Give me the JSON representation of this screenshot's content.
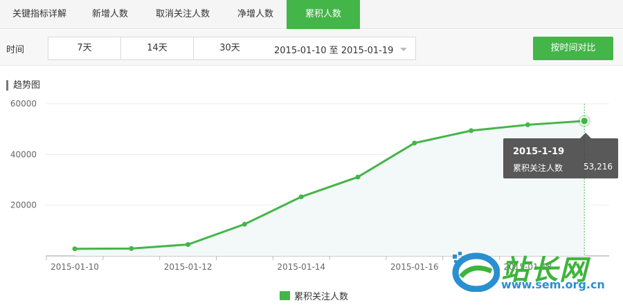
{
  "tabs": [
    {
      "label": "关键指标详解",
      "active": false
    },
    {
      "label": "新增人数",
      "active": false
    },
    {
      "label": "取消关注人数",
      "active": false
    },
    {
      "label": "净增人数",
      "active": false
    },
    {
      "label": "累积人数",
      "active": true
    }
  ],
  "filter": {
    "label": "时间",
    "periods": [
      "7天",
      "14天",
      "30天"
    ],
    "date_range": "2015-01-10 至 2015-01-19",
    "compare_button": "按时间对比"
  },
  "section_title": "趋势图",
  "tooltip": {
    "date": "2015-1-19",
    "series_name": "累积关注人数",
    "value": "53,216"
  },
  "legend": [
    "累积关注人数"
  ],
  "watermark": {
    "brand": "站长网",
    "url": "www.sem.org.cn"
  },
  "colors": {
    "accent": "#44b549",
    "tooltip_bg": "#3c3c3c",
    "watermark_url": "#2a8fd0"
  },
  "chart_data": {
    "type": "area",
    "x": [
      "2015-01-10",
      "2015-01-11",
      "2015-01-12",
      "2015-01-13",
      "2015-01-14",
      "2015-01-15",
      "2015-01-16",
      "2015-01-17",
      "2015-01-18",
      "2015-01-19"
    ],
    "xticks": [
      "2015-01-10",
      "2015-01-12",
      "2015-01-14",
      "2015-01-16",
      "2015-01-18"
    ],
    "series": [
      {
        "name": "累积关注人数",
        "values": [
          2800,
          2900,
          4500,
          12500,
          23300,
          31100,
          44500,
          49400,
          51700,
          53216
        ]
      }
    ],
    "yticks": [
      20000,
      40000,
      60000
    ],
    "ylim": [
      0,
      60000
    ],
    "grid": true,
    "highlight_index": 9,
    "legend_position": "bottom-center"
  }
}
